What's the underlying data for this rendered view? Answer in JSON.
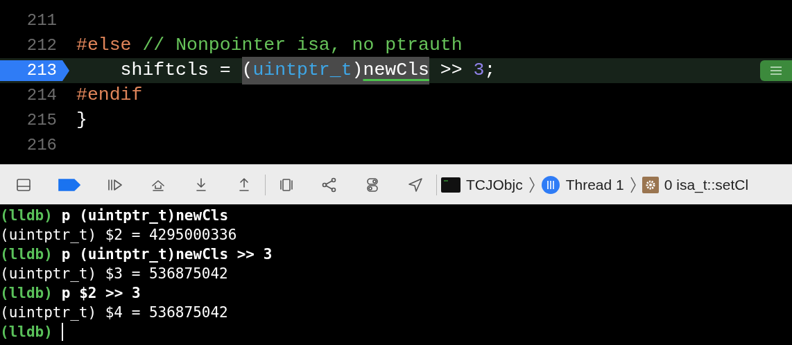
{
  "editor": {
    "lines": [
      {
        "number": "211",
        "current": false
      },
      {
        "number": "212",
        "current": false,
        "tokens": [
          {
            "text": "#else",
            "kind": "keyword",
            "selected": false
          },
          {
            "text": " // Nonpointer isa, no ptrauth",
            "kind": "comment",
            "selected": false
          }
        ]
      },
      {
        "number": "213",
        "current": true,
        "tokens": [
          {
            "text": "    shiftcls = ",
            "kind": "plain",
            "selected": false
          },
          {
            "text": "(",
            "kind": "plain",
            "selected": true
          },
          {
            "text": "uintptr_t",
            "kind": "type",
            "selected": true
          },
          {
            "text": ")",
            "kind": "plain",
            "selected": true
          },
          {
            "text": "newCls",
            "kind": "underlined",
            "selected": true
          },
          {
            "text": " >> ",
            "kind": "plain",
            "selected": false
          },
          {
            "text": "3",
            "kind": "number",
            "selected": false
          },
          {
            "text": ";",
            "kind": "plain",
            "selected": false
          }
        ]
      },
      {
        "number": "214",
        "current": false,
        "tokens": [
          {
            "text": "#endif",
            "kind": "keyword",
            "selected": false
          }
        ]
      },
      {
        "number": "215",
        "current": false,
        "tokens": [
          {
            "text": "}",
            "kind": "plain",
            "selected": false
          }
        ]
      },
      {
        "number": "216",
        "current": false
      }
    ]
  },
  "debug_bar": {
    "breakpoints_on": true,
    "path": [
      {
        "kind": "terminal",
        "label": "TCJObjc"
      },
      {
        "kind": "thread",
        "label": "Thread 1"
      },
      {
        "kind": "gear",
        "label": "0 isa_t::setCl"
      }
    ]
  },
  "console": {
    "lines": [
      {
        "kind": "command",
        "prompt": "(lldb)",
        "text": "p (uintptr_t)newCls"
      },
      {
        "kind": "output",
        "text": "(uintptr_t) $2 = 4295000336"
      },
      {
        "kind": "command",
        "prompt": "(lldb)",
        "text": "p (uintptr_t)newCls >> 3"
      },
      {
        "kind": "output",
        "text": "(uintptr_t) $3 = 536875042"
      },
      {
        "kind": "command",
        "prompt": "(lldb)",
        "text": "p $2 >> 3"
      },
      {
        "kind": "output",
        "text": "(uintptr_t) $4 = 536875042"
      },
      {
        "kind": "input",
        "prompt": "(lldb)"
      }
    ]
  }
}
